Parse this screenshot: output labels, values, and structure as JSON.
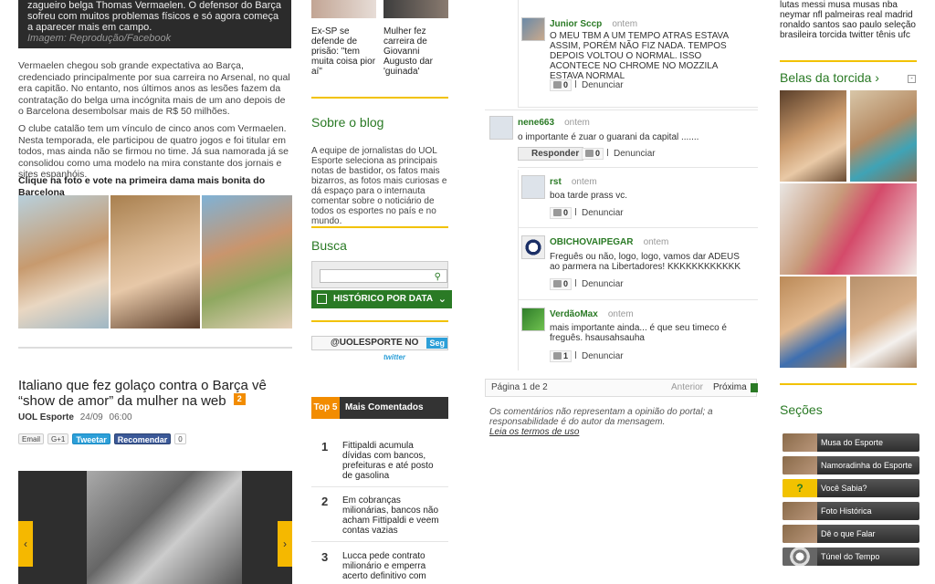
{
  "col1": {
    "caption_text": "zagueiro belga Thomas Vermaelen. O defensor do Barça sofreu com muitos problemas físicos e só agora começa a aparecer mais em campo.",
    "caption_credit": "Imagem: Reprodução/Facebook",
    "paragraph1": "Vermaelen chegou sob grande expectativa ao Barça, credenciado principalmente por sua carreira no Arsenal, no qual era capitão. No entanto, nos últimos anos as lesões fazem da contratação do belga uma incógnita mais de um ano depois de o Barcelona desembolsar mais de R$ 50 milhões.",
    "paragraph2": "O clube catalão tem um vínculo de cinco anos com Vermaelen. Nesta temporada, ele participou de quatro jogos e foi titular em todos, mas ainda não se firmou no time. Já sua namorada já se consolidou como uma modelo na mira constante dos jornais e sites espanhóis.",
    "cta": "Clique na foto e vote na primeira dama mais bonita do Barcelona",
    "article_title": "Italiano que fez golaço contra o Barça vê “show de amor” da mulher na web",
    "comment_count": "2",
    "source": "UOL Esporte",
    "date": "24/09",
    "time": "06:00",
    "share": {
      "email": "Email",
      "gplus": "G+1",
      "tweet": "Tweetar",
      "recommend": "Recomendar",
      "count": "0"
    }
  },
  "col2": {
    "thumbs": [
      {
        "caption": "Ex-SP se defende de prisão: \"tem muita coisa pior aí\""
      },
      {
        "caption": "Mulher fez carreira de Giovanni Augusto dar 'guinada'"
      }
    ],
    "about_title": "Sobre o blog",
    "about_text": "A equipe de jornalistas do UOL Esporte seleciona as principais notas de bastidor, os fatos mais bizarros, as fotos mais curiosas e dá espaço para o internauta comentar sobre o noticiário de todos os esportes no país e no mundo.",
    "search_title": "Busca",
    "history_label": "HISTÓRICO POR DATA",
    "twitter_follow": "@UOLESPORTE NO",
    "twitter_follow_btn": "Seg",
    "twitter_logo": "twitter",
    "top5_label": "Top 5",
    "top5_title": "Mais Comentados",
    "top5": [
      {
        "n": "1",
        "text": "Fittipaldi acumula dívidas com bancos, prefeituras e até posto de gasolina"
      },
      {
        "n": "2",
        "text": "Em cobranças milionárias, bancos não acham Fittipaldi e veem contas vazias"
      },
      {
        "n": "3",
        "text": "Lucca pede contrato milionário e emperra acerto definitivo com"
      }
    ]
  },
  "comments": [
    {
      "name": "Junior Sccp",
      "time": "ontem",
      "text": "O MEU TBM A UM TEMPO ATRAS ESTAVA ASSIM, PORÉM NÃO FIZ NADA. TEMPOS DEPOIS VOLTOU O NORMAL. ISSO ACONTECE NO CHROME NO MOZZILA ESTAVA NORMAL",
      "votes": "0",
      "report": "Denunciar"
    },
    {
      "name": "nene663",
      "time": "ontem",
      "text": "o importante é zuar o guarani da capital .......",
      "votes": "0",
      "report": "Denunciar",
      "reply": "Responder"
    },
    {
      "name": "rst",
      "time": "ontem",
      "text": "boa tarde prass vc.",
      "votes": "0",
      "report": "Denunciar"
    },
    {
      "name": "OBICHOVAIPEGAR",
      "time": "ontem",
      "text": "Freguês ou não, logo, logo, vamos dar ADEUS ao parmera na Libertadores! KKKKKKKKKKKK",
      "votes": "0",
      "report": "Denunciar"
    },
    {
      "name": "VerdãoMax",
      "time": "ontem",
      "text": "mais importante ainda... é que seu timeco é freguês. hsausahsauha",
      "votes": "1",
      "report": "Denunciar"
    }
  ],
  "pager": {
    "label": "Página 1 de 2",
    "prev": "Anterior",
    "next": "Próxima"
  },
  "disclaimer": "Os comentários não representam a opinião do portal; a responsabilidade é do autor da mensagem.",
  "disclaimer_link": "Leia os termos de uso",
  "col4": {
    "tags": "lutas messi musa musas nba neymar nfl palmeiras real madrid ronaldo santos sao paulo seleção brasileira torcida twitter tênis ufc",
    "belas_title": "Belas da torcida ›",
    "belas_ctl": "-",
    "secoes_title": "Seções",
    "secoes": [
      "Musa do Esporte",
      "Namoradinha do Esporte",
      "Você Sabia?",
      "Foto Histórica",
      "Dê o que Falar",
      "Túnel do Tempo"
    ]
  },
  "colors": {
    "green": "#2a7a25",
    "yellow": "#f2c200",
    "orange": "#f28c00"
  }
}
